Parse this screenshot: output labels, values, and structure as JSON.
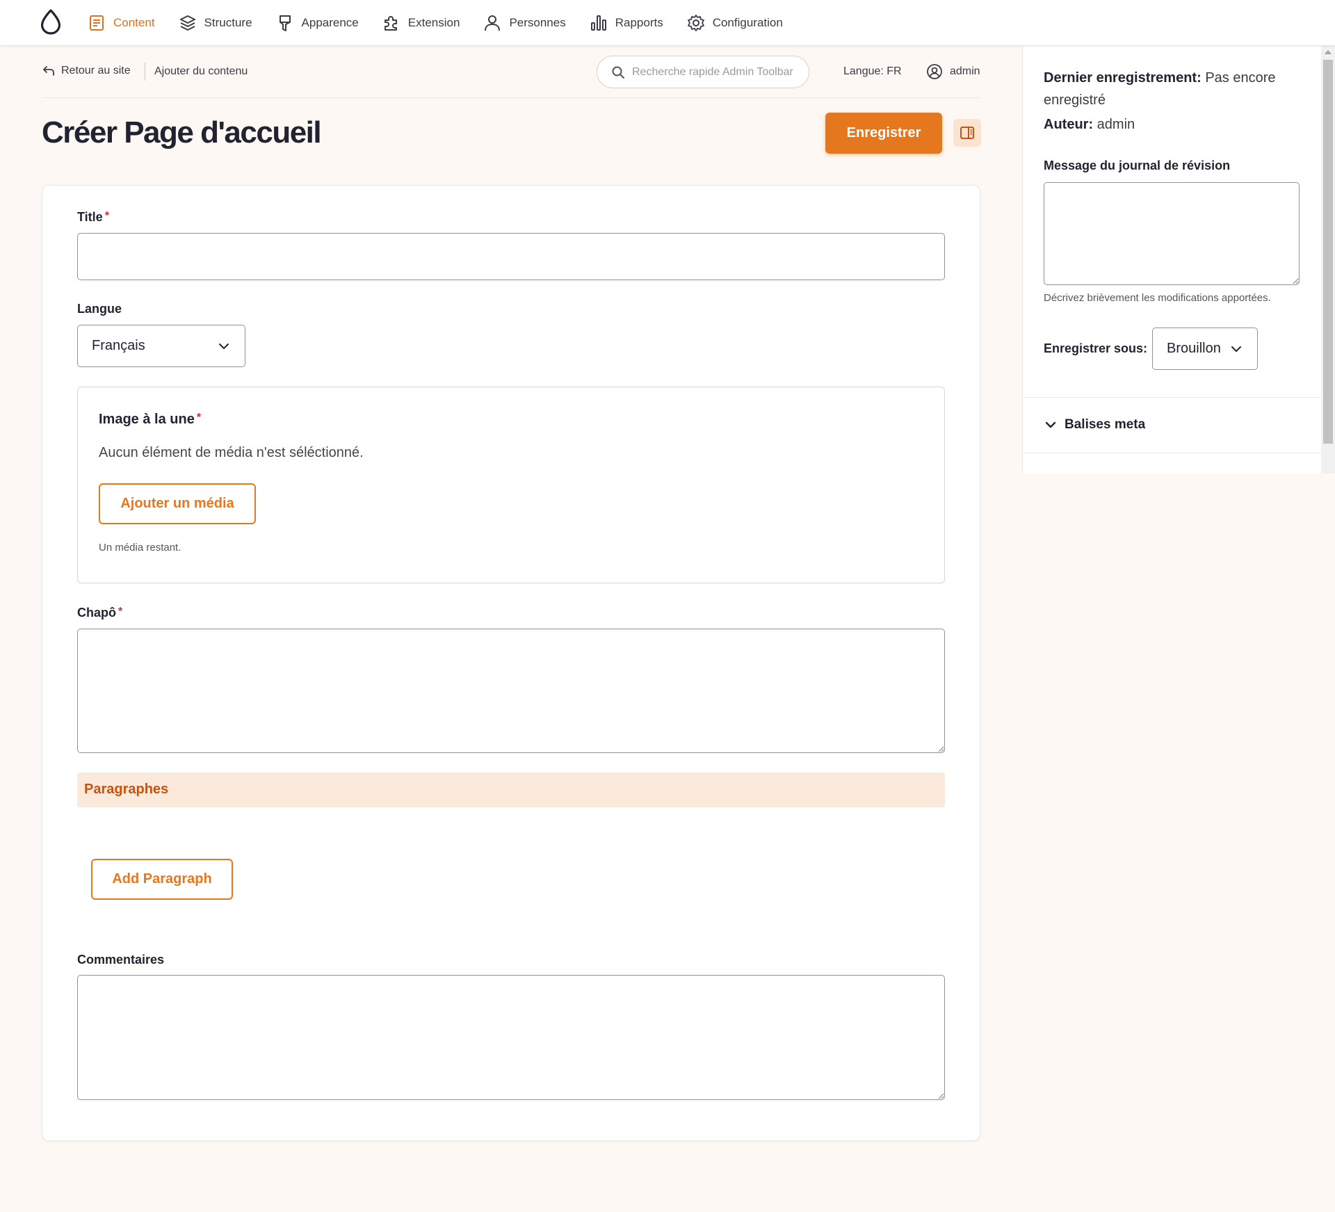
{
  "toolbar": {
    "nav": [
      {
        "label": "Content",
        "icon": "content-icon",
        "active": true
      },
      {
        "label": "Structure",
        "icon": "layers-icon"
      },
      {
        "label": "Apparence",
        "icon": "brush-icon"
      },
      {
        "label": "Extension",
        "icon": "puzzle-icon"
      },
      {
        "label": "Personnes",
        "icon": "person-icon"
      },
      {
        "label": "Rapports",
        "icon": "bar-chart-icon"
      },
      {
        "label": "Configuration",
        "icon": "gear-icon"
      }
    ],
    "accent_color": "#e0701b"
  },
  "secondary": {
    "back_label": "Retour au site",
    "add_content_label": "Ajouter du contenu",
    "search_placeholder": "Recherche rapide Admin Toolbar",
    "language_label": "Langue: FR",
    "user_label": "admin"
  },
  "page": {
    "title": "Créer Page d'accueil",
    "save_label": "Enregistrer"
  },
  "form": {
    "title_label": "Title",
    "title_value": "",
    "language_label": "Langue",
    "language_value": "Français",
    "media": {
      "label": "Image à la une",
      "empty_text": "Aucun élément de média n'est séléctionné.",
      "add_label": "Ajouter un média",
      "help": "Un média restant."
    },
    "chapo_label": "Chapô",
    "paragraphs_title": "Paragraphes",
    "add_paragraph_label": "Add Paragraph",
    "comments_label": "Commentaires"
  },
  "sidebar": {
    "last_saved_label": "Dernier enregistrement:",
    "last_saved_value": "Pas encore enregistré",
    "author_label": "Auteur:",
    "author_value": "admin",
    "revision_label": "Message du journal de révision",
    "revision_help": "Décrivez brièvement les modifications apportées.",
    "state_label": "Enregistrer sous:",
    "state_value": "Brouillon",
    "meta_label": "Balises meta"
  }
}
